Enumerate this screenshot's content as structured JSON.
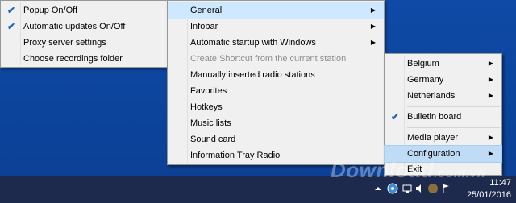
{
  "left_menu": [
    {
      "label": "Popup On/Off",
      "checked": true
    },
    {
      "label": "Automatic updates On/Off",
      "checked": true
    },
    {
      "label": "Proxy server settings",
      "checked": false
    },
    {
      "label": "Choose recordings folder",
      "checked": false
    }
  ],
  "mid_menu": [
    {
      "label": "General",
      "submenu": true,
      "disabled": false
    },
    {
      "label": "Infobar",
      "submenu": true,
      "disabled": false
    },
    {
      "label": "Automatic startup with Windows",
      "submenu": true,
      "disabled": false
    },
    {
      "label": "Create Shortcut from the current station",
      "submenu": false,
      "disabled": true
    },
    {
      "label": "Manually inserted radio stations",
      "submenu": false,
      "disabled": false
    },
    {
      "label": "Favorites",
      "submenu": false,
      "disabled": false
    },
    {
      "label": "Hotkeys",
      "submenu": false,
      "disabled": false
    },
    {
      "label": "Music lists",
      "submenu": false,
      "disabled": false
    },
    {
      "label": "Sound card",
      "submenu": false,
      "disabled": false
    },
    {
      "label": "Information Tray Radio",
      "submenu": false,
      "disabled": false
    }
  ],
  "right_menu": [
    {
      "label": "Belgium",
      "submenu": true
    },
    {
      "label": "Germany",
      "submenu": true
    },
    {
      "label": "Netherlands",
      "submenu": true
    },
    {
      "label": "Bulletin board",
      "checked": true
    },
    {
      "label": "Media player",
      "submenu": true
    },
    {
      "label": "Configuration",
      "submenu": true
    },
    {
      "label": "Exit"
    }
  ],
  "taskbar": {
    "time": "11:47",
    "date": "25/01/2016",
    "watermark_main": "Download",
    "watermark_domain": ".com.vn"
  },
  "icons": {
    "check": "checkmark-icon",
    "arrow": "submenu-arrow-icon"
  }
}
